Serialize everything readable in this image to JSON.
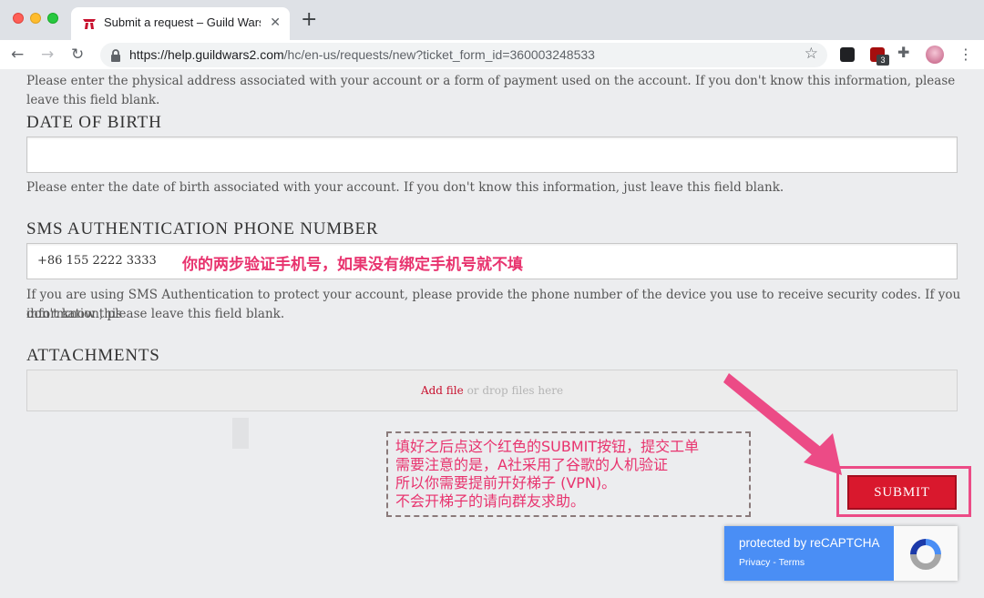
{
  "browser": {
    "tab_title": "Submit a request – Guild Wars",
    "tab_close": "✕",
    "new_tab": "+",
    "url_host": "https://help.guildwars2.com",
    "url_path": "/hc/en-us/requests/new?ticket_form_id=360003248533",
    "nav_back": "←",
    "nav_forward": "→",
    "nav_reload": "↻",
    "star": "☆",
    "extensions_icon": "✚",
    "menu": "⋮",
    "extension_badge": "3"
  },
  "form": {
    "address_help": "Please enter the physical address associated with your account or a form of payment used on the account. If you don't know this information, please leave this field blank.",
    "dob_label": "DATE OF BIRTH",
    "dob_value": "",
    "dob_help": "Please enter the date of birth associated with your account. If you don't know this information, just leave this field blank.",
    "sms_label": "SMS AUTHENTICATION PHONE NUMBER",
    "sms_value": "+86 155 2222 3333",
    "sms_annotation": "你的两步验证手机号，如果没有绑定手机号就不填",
    "sms_help_line1": "If you are using SMS Authentication to protect your account, please provide the phone number of the device you use to receive security codes. If you don't know this",
    "sms_help_line2": "information, please leave this field blank.",
    "attachments_label": "ATTACHMENTS",
    "add_file": "Add file",
    "drop_text": "or drop files here",
    "submit_label": "SUBMIT"
  },
  "callout": {
    "line1": "填好之后点这个红色的SUBMIT按钮，提交工单",
    "line2": "需要注意的是，A社采用了谷歌的人机验证",
    "line3": "所以你需要提前开好梯子 (VPN)。",
    "line4": "不会开梯子的请向群友求助。"
  },
  "recaptcha": {
    "title": "protected by reCAPTCHA",
    "privacy": "Privacy",
    "separator": " - ",
    "terms": "Terms"
  },
  "colors": {
    "annotation": "#e8336e",
    "submit": "#d9182d",
    "recaptcha_blue": "#4a8ef5",
    "arrow": "#ec4b86"
  }
}
